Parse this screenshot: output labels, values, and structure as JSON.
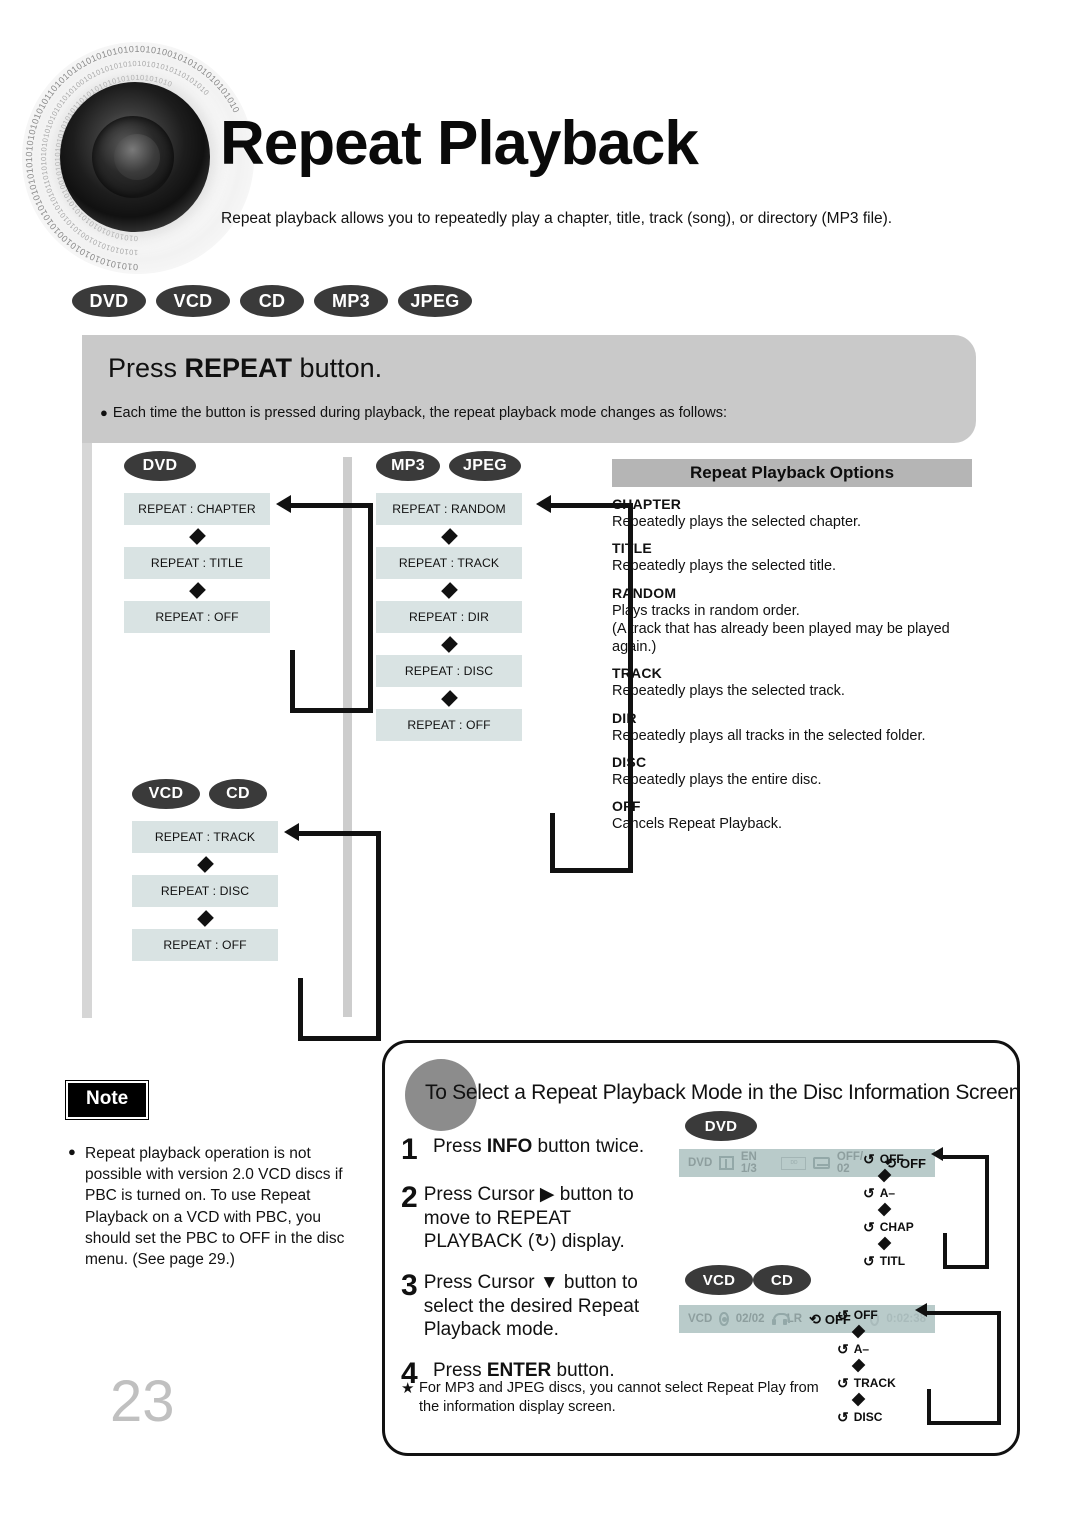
{
  "header": {
    "title": "Repeat Playback",
    "subtitle": "Repeat playback allows you to repeatedly play a chapter, title, track (song), or directory (MP3 file).",
    "logo_icon": "speaker-binary-logo"
  },
  "media_badges": [
    "DVD",
    "VCD",
    "CD",
    "MP3",
    "JPEG"
  ],
  "instruction_panel": {
    "title_prefix": "Press ",
    "title_strong": "REPEAT",
    "title_suffix": " button.",
    "bullet": "Each time the button is pressed during playback, the repeat playback mode changes as follows:"
  },
  "flows": [
    {
      "id": "dvd",
      "badges": [
        "DVD"
      ],
      "steps": [
        "REPEAT : CHAPTER",
        "REPEAT : TITLE",
        "REPEAT : OFF"
      ]
    },
    {
      "id": "vcd-cd",
      "badges": [
        "VCD",
        "CD"
      ],
      "steps": [
        "REPEAT : TRACK",
        "REPEAT : DISC",
        "REPEAT : OFF"
      ]
    },
    {
      "id": "mp3-jpeg",
      "badges": [
        "MP3",
        "JPEG"
      ],
      "steps": [
        "REPEAT : RANDOM",
        "REPEAT : TRACK",
        "REPEAT : DIR",
        "REPEAT : DISC",
        "REPEAT : OFF"
      ]
    }
  ],
  "options": {
    "heading": "Repeat Playback Options",
    "items": [
      {
        "term": "CHAPTER",
        "desc": "Repeatedly plays the selected chapter."
      },
      {
        "term": "TITLE",
        "desc": "Repeatedly plays the selected title."
      },
      {
        "term": "RANDOM",
        "desc": "Plays tracks in random order.\n(A track that has already been played may be played again.)"
      },
      {
        "term": "TRACK",
        "desc": "Repeatedly plays the selected track."
      },
      {
        "term": "DIR",
        "desc": "Repeatedly plays all tracks in the selected folder."
      },
      {
        "term": "DISC",
        "desc": "Repeatedly plays the entire disc."
      },
      {
        "term": "OFF",
        "desc": "Cancels Repeat Playback."
      }
    ]
  },
  "note": {
    "label": "Note",
    "text": "Repeat playback operation is not possible with version 2.0 VCD discs if PBC is turned on. To use Repeat Playback on a VCD with PBC, you should set the PBC to OFF in the disc menu. (See page 29.)"
  },
  "page_number": "23",
  "bottom": {
    "title": "To Select a Repeat Playback Mode in the Disc Information Screen",
    "steps": [
      {
        "num": "1",
        "pre": "Press ",
        "strong": "INFO",
        "post": " button twice."
      },
      {
        "num": "2",
        "pre": "Press Cursor ▶ button to move to REPEAT PLAYBACK (↻) display.",
        "strong": "",
        "post": ""
      },
      {
        "num": "3",
        "pre": "Press Cursor ▼ button to select the desired Repeat Playback mode.",
        "strong": "",
        "post": ""
      },
      {
        "num": "4",
        "pre": "Press ",
        "strong": "ENTER",
        "post": " button."
      }
    ],
    "footnote": "For MP3 and JPEG discs, you cannot select Repeat Play from the information display screen.",
    "footnote_marker": "★",
    "dvd_screen": {
      "badges": [
        "DVD"
      ],
      "osd": {
        "disc_type": "DVD",
        "audio": "EN 1/3",
        "audio_format": "DOLBY DIGITAL",
        "subtitle": "OFF/ 02",
        "repeat": "OFF"
      },
      "repeat_cycle": [
        "OFF",
        "A–",
        "CHAP",
        "TITL"
      ]
    },
    "vcd_screen": {
      "badges": [
        "VCD",
        "CD"
      ],
      "osd": {
        "disc_type": "VCD",
        "track": "02/02",
        "audio_channel": "LR",
        "repeat": "OFF",
        "time": "0:02:38"
      },
      "repeat_cycle": [
        "OFF",
        "A–",
        "TRACK",
        "DISC"
      ]
    }
  },
  "colors": {
    "badge_bg": "#3a3a3a",
    "grey_panel": "#c9c9c9",
    "stepbox_bg": "#d9e3e3",
    "options_head_bg": "#b5b5b5",
    "osd_bg": "#b9cbca",
    "page_number": "#c0c0c0"
  }
}
